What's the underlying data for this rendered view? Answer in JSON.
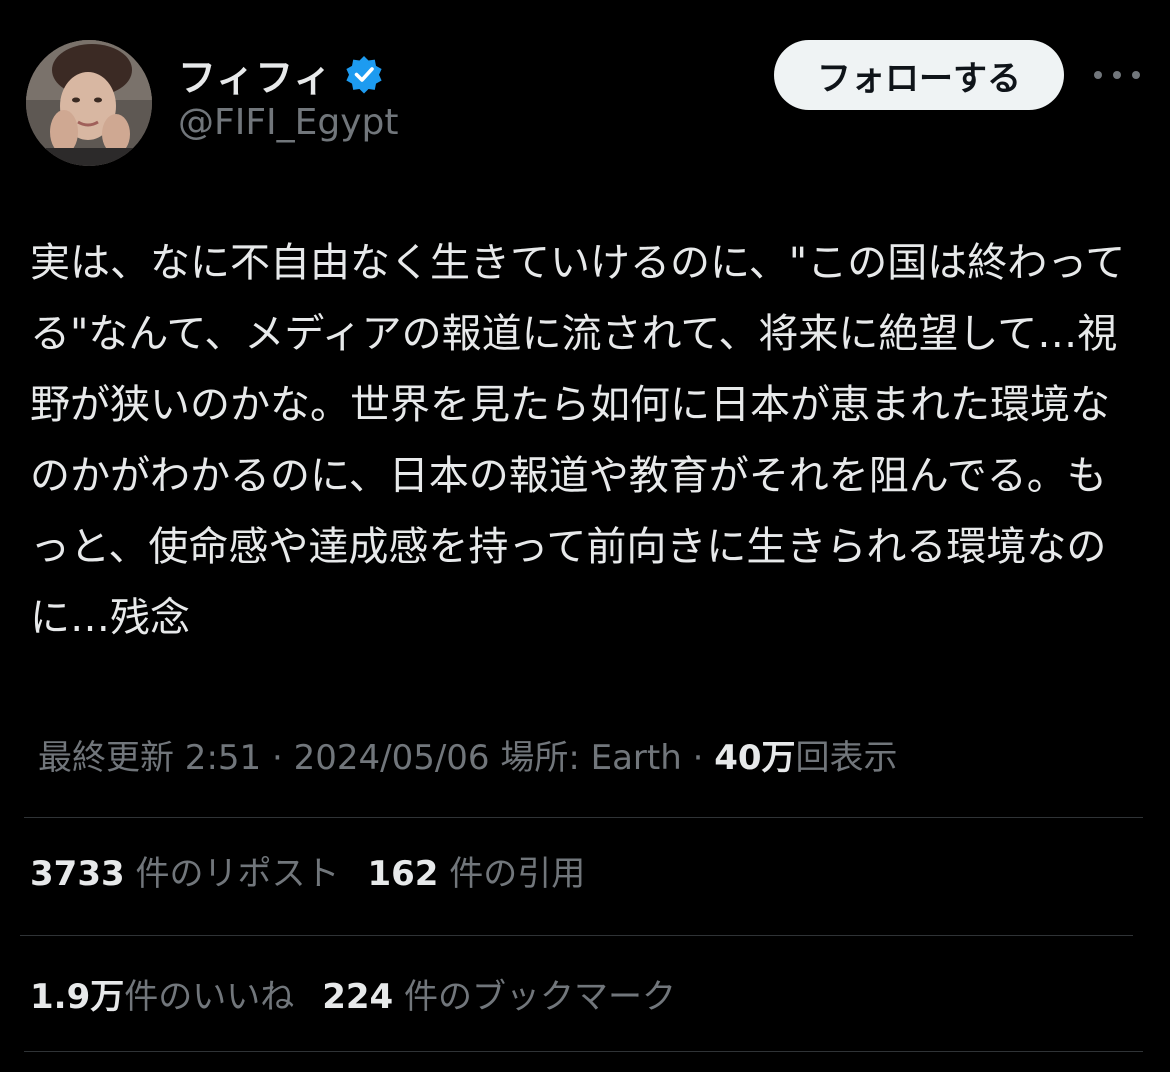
{
  "user": {
    "display_name": "フィフィ",
    "handle": "@FIFI_Egypt",
    "verified_icon": "verified-badge-icon",
    "verified_color": "#1d9bf0"
  },
  "follow_button": {
    "label": "フォローする"
  },
  "more_button": {
    "icon": "more-horizontal-icon"
  },
  "tweet": {
    "text": "実は、なに不自由なく生きていけるのに、\"この国は終わってる\"なんて、メディアの報道に流されて、将来に絶望して…視野が狭いのかな。世界を見たら如何に日本が恵まれた環境なのかがわかるのに、日本の報道や教育がそれを阻んでる。もっと、使命感や達成感を持って前向きに生きられる環境なのに…残念"
  },
  "meta": {
    "last_updated": "最終更新 2:51 · 2024/05/06  場所: Earth · ",
    "views_count": "40万",
    "views_label": "回表示"
  },
  "stats": {
    "reposts_count": "3733",
    "reposts_label": " 件のリポスト",
    "quotes_count": "162",
    "quotes_label": " 件の引用",
    "likes_count": "1.9万",
    "likes_label": "件のいいね",
    "bookmarks_count": "224",
    "bookmarks_label": " 件のブックマーク"
  },
  "colors": {
    "background": "#000000",
    "text_primary": "#e7e9ea",
    "text_secondary": "#71767b",
    "divider": "#2f3336",
    "button_bg": "#eff3f4"
  }
}
